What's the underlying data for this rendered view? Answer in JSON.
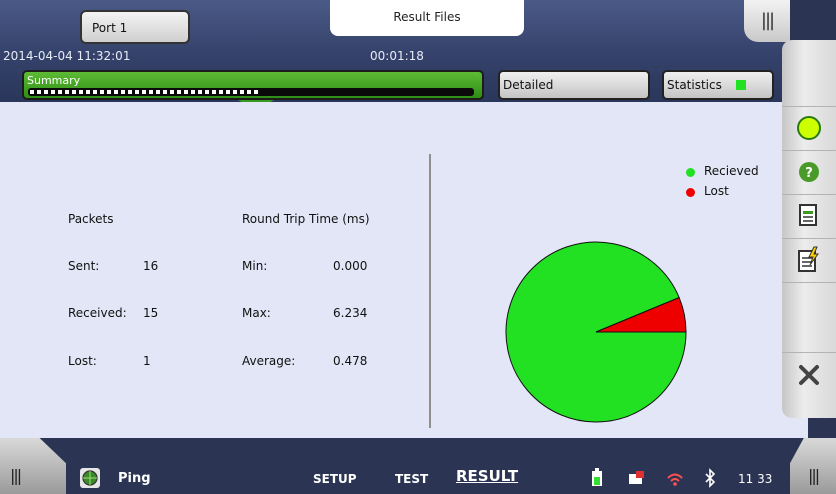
{
  "header": {
    "port_label": "Port 1",
    "result_files_label": "Result Files",
    "menu_handle_label": "|||",
    "datetime": "2014-04-04 11:32:01",
    "elapsed": "00:01:18"
  },
  "tabs": {
    "summary_label": "Summary",
    "detailed_label": "Detailed",
    "statistics_label": "Statistics",
    "progress_fraction": 0.52,
    "statistics_indicator_color": "#22e022"
  },
  "stats": {
    "packets_header": "Packets",
    "sent_label": "Sent:",
    "sent_value": "16",
    "received_label": "Received:",
    "received_value": "15",
    "lost_label": "Lost:",
    "lost_value": "1",
    "rtt_header": "Round Trip Time (ms)",
    "min_label": "Min:",
    "min_value": "0.000",
    "max_label": "Max:",
    "max_value": "6.234",
    "avg_label": "Average:",
    "avg_value": "0.478"
  },
  "chart_data": {
    "type": "pie",
    "categories": [
      "Recieved",
      "Lost"
    ],
    "values": [
      15,
      1
    ],
    "colors": [
      "#22e022",
      "#ee0000"
    ],
    "legend_position": "top-right"
  },
  "sidebar": {
    "icons": [
      "status-indicator-icon",
      "help-icon",
      "report-icon",
      "quick-report-icon",
      "close-icon"
    ],
    "help_glyph": "?"
  },
  "bottom": {
    "left_handle_label": "|||",
    "right_handle_label": "|||",
    "app_name": "Ping",
    "setup_label": "SETUP",
    "test_label": "TEST",
    "result_label": "RESULT",
    "time": "11 33"
  }
}
